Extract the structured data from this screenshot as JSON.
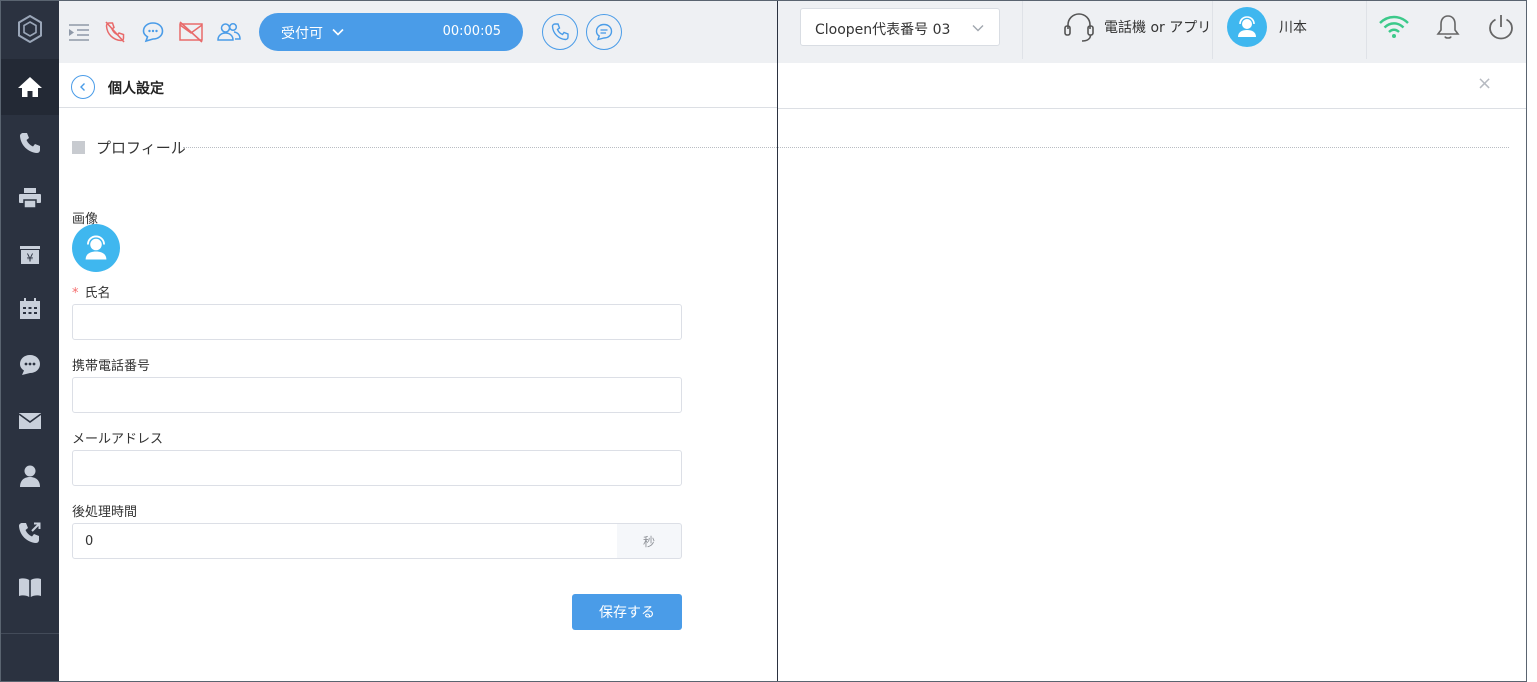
{
  "toolbar": {
    "status_label": "受付可",
    "status_timer": "00:00:05"
  },
  "header": {
    "number_select": "Cloopen代表番号 03",
    "device_label": "電話機 or アプリ",
    "user_name": "川本"
  },
  "panel": {
    "title": "個人設定",
    "close": "×",
    "section_title": "プロフィール"
  },
  "form": {
    "image_label": "画像",
    "required_mark": "*",
    "name_label": "氏名",
    "name_value": "",
    "phone_label": "携帯電話番号",
    "phone_value": "",
    "email_label": "メールアドレス",
    "email_value": "",
    "wrapup_label": "後処理時間",
    "wrapup_value": "0",
    "wrapup_unit": "秒",
    "save_label": "保存する"
  },
  "colors": {
    "accent": "#4a9ce8",
    "sidebar": "#2b3240",
    "avatar": "#3fb7ef",
    "alert_red": "#e86a6a",
    "wifi_green": "#3cc98a"
  },
  "icons": {
    "sidebar": [
      "home-icon",
      "phone-icon",
      "fax-icon",
      "billing-icon",
      "calendar-icon",
      "chat-icon",
      "mail-icon",
      "contacts-icon",
      "transfer-icon",
      "book-icon",
      "stats-icon"
    ]
  }
}
